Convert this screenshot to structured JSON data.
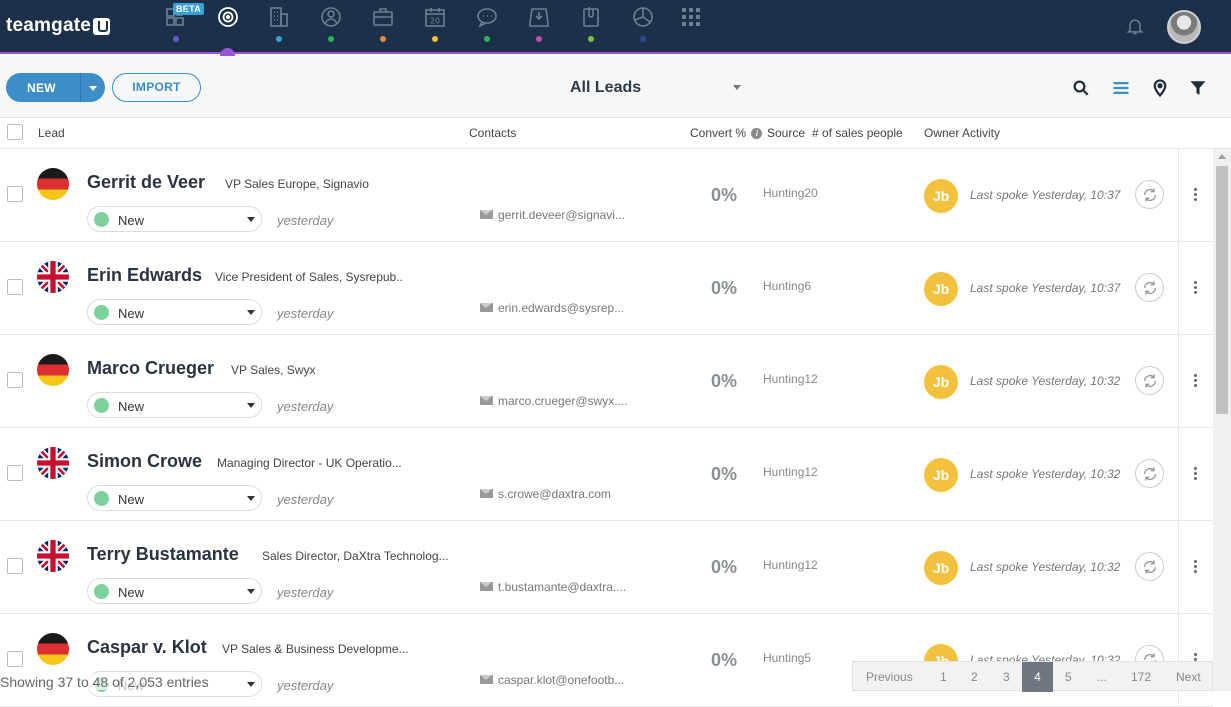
{
  "app": {
    "logo_text": "teamgate"
  },
  "nav": {
    "beta_label": "BETA",
    "items": [
      {
        "icon": "dashboard-icon",
        "dot": "#6a5acd"
      },
      {
        "icon": "leads-target-icon",
        "dot": "#9a55d6"
      },
      {
        "icon": "companies-icon",
        "dot": "#3aa0d8"
      },
      {
        "icon": "contacts-icon",
        "dot": "#2ab55a"
      },
      {
        "icon": "deals-briefcase-icon",
        "dot": "#e38b3a"
      },
      {
        "icon": "calendar-icon",
        "calendar_number": "20",
        "dot": "#f2c23f"
      },
      {
        "icon": "chat-icon",
        "dot": "#2ab55a"
      },
      {
        "icon": "inbox-icon",
        "dot": "#c050b0"
      },
      {
        "icon": "documents-icon",
        "dot": "#7ac143"
      },
      {
        "icon": "reports-pie-icon",
        "dot": "#2d4a8a"
      },
      {
        "icon": "apps-grid-icon"
      }
    ]
  },
  "toolbar": {
    "new_label": "NEW",
    "import_label": "IMPORT",
    "view_title": "All Leads"
  },
  "columns": {
    "lead": "Lead",
    "contacts": "Contacts",
    "convert": "Convert %",
    "source": "Source",
    "sales_people": "# of sales people",
    "owner": "Owner",
    "activity": "Activity"
  },
  "leads": [
    {
      "flag": "de",
      "name": "Gerrit de Veer",
      "title": "VP Sales Europe, Signavio",
      "status": "New",
      "when": "yesterday",
      "email": "gerrit.deveer@signavi...",
      "convert": "0%",
      "source": "Hunting",
      "sales_people": "20",
      "owner_initials": "Jb",
      "activity": "Last spoke Yesterday, 10:37"
    },
    {
      "flag": "uk",
      "name": "Erin Edwards",
      "title": "Vice President of Sales, Sysrepub..",
      "status": "New",
      "when": "yesterday",
      "email": "erin.edwards@sysrep...",
      "convert": "0%",
      "source": "Hunting",
      "sales_people": "6",
      "owner_initials": "Jb",
      "activity": "Last spoke Yesterday, 10:37"
    },
    {
      "flag": "de",
      "name": "Marco Crueger",
      "title": "VP Sales, Swyx",
      "status": "New",
      "when": "yesterday",
      "email": "marco.crueger@swyx....",
      "convert": "0%",
      "source": "Hunting",
      "sales_people": "12",
      "owner_initials": "Jb",
      "activity": "Last spoke Yesterday, 10:32"
    },
    {
      "flag": "uk",
      "name": "Simon Crowe",
      "title": "Managing Director - UK Operatio...",
      "status": "New",
      "when": "yesterday",
      "email": "s.crowe@daxtra.com",
      "convert": "0%",
      "source": "Hunting",
      "sales_people": "12",
      "owner_initials": "Jb",
      "activity": "Last spoke Yesterday, 10:32"
    },
    {
      "flag": "uk",
      "name": "Terry Bustamante",
      "title": "Sales Director, DaXtra Technolog...",
      "status": "New",
      "when": "yesterday",
      "email": "t.bustamante@daxtra....",
      "convert": "0%",
      "source": "Hunting",
      "sales_people": "12",
      "owner_initials": "Jb",
      "activity": "Last spoke Yesterday, 10:32"
    },
    {
      "flag": "de",
      "name": "Caspar v. Klot",
      "title": "VP Sales & Business Developme...",
      "status": "New",
      "when": "yesterday",
      "email": "caspar.klot@onefootb...",
      "convert": "0%",
      "source": "Hunting",
      "sales_people": "5",
      "owner_initials": "Jb",
      "activity": "Last spoke Yesterday, 10:32"
    }
  ],
  "footer": {
    "entries_text": "Showing 37 to 48 of 2,053 entries",
    "pager": {
      "previous": "Previous",
      "pages": [
        "1",
        "2",
        "3",
        "4",
        "5",
        "...",
        "172"
      ],
      "current": "4",
      "next": "Next"
    }
  }
}
